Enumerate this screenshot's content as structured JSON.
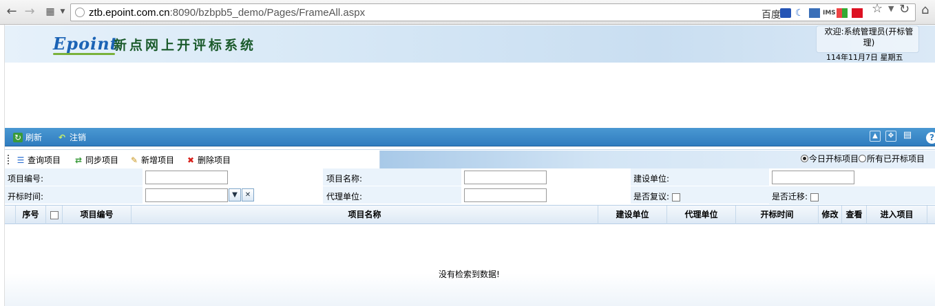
{
  "browser": {
    "url_host": "ztb.epoint.com.cn",
    "url_rest": ":8090/bzbpb5_demo/Pages/FrameAll.aspx",
    "search_engine": "百度"
  },
  "banner": {
    "logo_text": "Epoint",
    "system_title": "新点网上开评标系统",
    "welcome": "欢迎:系统管理员(开标管理)",
    "date": "114年11月7日  星期五"
  },
  "main_toolbar": {
    "refresh_label": "刷新",
    "logout_label": "注销",
    "help_glyph": "?"
  },
  "actions": {
    "query_label": "查询项目",
    "sync_label": "同步项目",
    "add_label": "新增项目",
    "delete_label": "删除项目"
  },
  "filter_radio": {
    "today_label": "今日开标项目",
    "all_label": "所有已开标项目",
    "selected": "today"
  },
  "form": {
    "project_no_label": "项目编号:",
    "project_name_label": "项目名称:",
    "build_unit_label": "建设单位:",
    "open_time_label": "开标时间:",
    "agent_unit_label": "代理单位:",
    "review_label": "是否复议:",
    "migrate_label": "是否迁移:",
    "project_no_value": "",
    "project_name_value": "",
    "build_unit_value": "",
    "open_time_value": "",
    "agent_unit_value": ""
  },
  "grid": {
    "columns": [
      "序号",
      "项目编号",
      "项目名称",
      "建设单位",
      "代理单位",
      "开标时间",
      "修改",
      "查看",
      "进入项目"
    ],
    "rows": [],
    "empty_message": "没有检索到数据!"
  },
  "colors": {
    "toolbar_blue": "#2f7cbf",
    "banner_title_green": "#1a5a2b",
    "logo_blue": "#1b63b5",
    "form_row_bg": "#eaf3fb"
  }
}
